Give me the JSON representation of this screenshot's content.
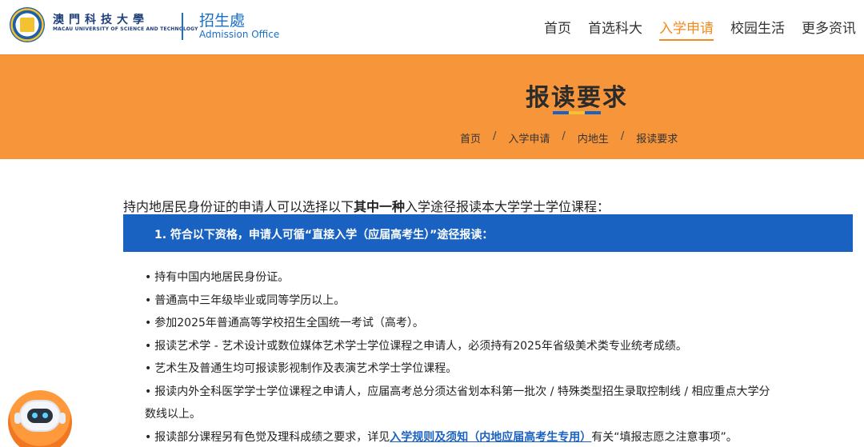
{
  "header": {
    "logo_cn": "澳門科技大學",
    "logo_en": "MACAU UNIVERSITY OF SCIENCE AND TECHNOLOGY",
    "office_cn": "招生處",
    "office_en": "Admission Office",
    "nav": [
      {
        "label": "首页",
        "active": false
      },
      {
        "label": "首选科大",
        "active": false
      },
      {
        "label": "入学申请",
        "active": true
      },
      {
        "label": "校园生活",
        "active": false
      },
      {
        "label": "更多资讯",
        "active": false
      }
    ],
    "accent_color": "#f28a20"
  },
  "banner": {
    "title": "报读要求",
    "background": "#f7953b",
    "underline_colors": [
      "#1a62c2",
      "#f2c230",
      "#1a62c2"
    ],
    "breadcrumb": [
      "首页",
      "入学申请",
      "内地生",
      "报读要求"
    ],
    "separator": "/"
  },
  "content": {
    "intro_prefix": "持内地居民身份证的申请人可以选择以下",
    "intro_bold": "其中一种",
    "intro_suffix": "入学途径报读本大学学士学位课程：",
    "section_title": "1. 符合以下资格，申请人可循“直接入学（应届高考生）”途径报读：",
    "section_color": "#1a62c2",
    "bullet": "•",
    "items": [
      "持有中国内地居民身份证。",
      "普通高中三年级毕业或同等学历以上。",
      "参加2025年普通高等学校招生全国统一考试（高考）。",
      "报读艺术学 - 艺术设计或数位媒体艺术学士学位课程之申请人，必须持有2025年省级美术类专业统考成绩。",
      "艺术生及普通生均可报读影视制作及表演艺术学士学位课程。",
      "报读内外全科医学学士学位课程之申请人，应届高考总分须达省划本科第一批次 / 特殊类型招生录取控制线 / 相应重点大学分",
      "数线以上。"
    ],
    "last_item_prefix": "报读部分课程另有色觉及理科成绩之要求，详见",
    "last_item_link": "入学规则及须知（内地应届高考生专用）",
    "last_item_suffix": "有关“填报志愿之注意事项”。"
  },
  "chatbot": {
    "icon": "robot-icon"
  }
}
